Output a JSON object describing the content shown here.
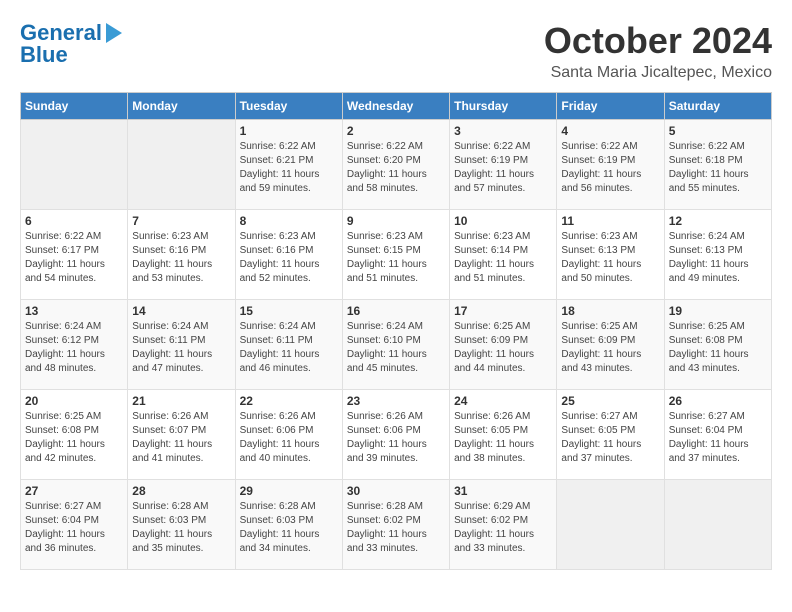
{
  "logo": {
    "line1": "General",
    "line2": "Blue"
  },
  "header": {
    "month": "October 2024",
    "location": "Santa Maria Jicaltepec, Mexico"
  },
  "weekdays": [
    "Sunday",
    "Monday",
    "Tuesday",
    "Wednesday",
    "Thursday",
    "Friday",
    "Saturday"
  ],
  "weeks": [
    [
      {
        "day": "",
        "sunrise": "",
        "sunset": "",
        "daylight": ""
      },
      {
        "day": "",
        "sunrise": "",
        "sunset": "",
        "daylight": ""
      },
      {
        "day": "1",
        "sunrise": "Sunrise: 6:22 AM",
        "sunset": "Sunset: 6:21 PM",
        "daylight": "Daylight: 11 hours and 59 minutes."
      },
      {
        "day": "2",
        "sunrise": "Sunrise: 6:22 AM",
        "sunset": "Sunset: 6:20 PM",
        "daylight": "Daylight: 11 hours and 58 minutes."
      },
      {
        "day": "3",
        "sunrise": "Sunrise: 6:22 AM",
        "sunset": "Sunset: 6:19 PM",
        "daylight": "Daylight: 11 hours and 57 minutes."
      },
      {
        "day": "4",
        "sunrise": "Sunrise: 6:22 AM",
        "sunset": "Sunset: 6:19 PM",
        "daylight": "Daylight: 11 hours and 56 minutes."
      },
      {
        "day": "5",
        "sunrise": "Sunrise: 6:22 AM",
        "sunset": "Sunset: 6:18 PM",
        "daylight": "Daylight: 11 hours and 55 minutes."
      }
    ],
    [
      {
        "day": "6",
        "sunrise": "Sunrise: 6:22 AM",
        "sunset": "Sunset: 6:17 PM",
        "daylight": "Daylight: 11 hours and 54 minutes."
      },
      {
        "day": "7",
        "sunrise": "Sunrise: 6:23 AM",
        "sunset": "Sunset: 6:16 PM",
        "daylight": "Daylight: 11 hours and 53 minutes."
      },
      {
        "day": "8",
        "sunrise": "Sunrise: 6:23 AM",
        "sunset": "Sunset: 6:16 PM",
        "daylight": "Daylight: 11 hours and 52 minutes."
      },
      {
        "day": "9",
        "sunrise": "Sunrise: 6:23 AM",
        "sunset": "Sunset: 6:15 PM",
        "daylight": "Daylight: 11 hours and 51 minutes."
      },
      {
        "day": "10",
        "sunrise": "Sunrise: 6:23 AM",
        "sunset": "Sunset: 6:14 PM",
        "daylight": "Daylight: 11 hours and 51 minutes."
      },
      {
        "day": "11",
        "sunrise": "Sunrise: 6:23 AM",
        "sunset": "Sunset: 6:13 PM",
        "daylight": "Daylight: 11 hours and 50 minutes."
      },
      {
        "day": "12",
        "sunrise": "Sunrise: 6:24 AM",
        "sunset": "Sunset: 6:13 PM",
        "daylight": "Daylight: 11 hours and 49 minutes."
      }
    ],
    [
      {
        "day": "13",
        "sunrise": "Sunrise: 6:24 AM",
        "sunset": "Sunset: 6:12 PM",
        "daylight": "Daylight: 11 hours and 48 minutes."
      },
      {
        "day": "14",
        "sunrise": "Sunrise: 6:24 AM",
        "sunset": "Sunset: 6:11 PM",
        "daylight": "Daylight: 11 hours and 47 minutes."
      },
      {
        "day": "15",
        "sunrise": "Sunrise: 6:24 AM",
        "sunset": "Sunset: 6:11 PM",
        "daylight": "Daylight: 11 hours and 46 minutes."
      },
      {
        "day": "16",
        "sunrise": "Sunrise: 6:24 AM",
        "sunset": "Sunset: 6:10 PM",
        "daylight": "Daylight: 11 hours and 45 minutes."
      },
      {
        "day": "17",
        "sunrise": "Sunrise: 6:25 AM",
        "sunset": "Sunset: 6:09 PM",
        "daylight": "Daylight: 11 hours and 44 minutes."
      },
      {
        "day": "18",
        "sunrise": "Sunrise: 6:25 AM",
        "sunset": "Sunset: 6:09 PM",
        "daylight": "Daylight: 11 hours and 43 minutes."
      },
      {
        "day": "19",
        "sunrise": "Sunrise: 6:25 AM",
        "sunset": "Sunset: 6:08 PM",
        "daylight": "Daylight: 11 hours and 43 minutes."
      }
    ],
    [
      {
        "day": "20",
        "sunrise": "Sunrise: 6:25 AM",
        "sunset": "Sunset: 6:08 PM",
        "daylight": "Daylight: 11 hours and 42 minutes."
      },
      {
        "day": "21",
        "sunrise": "Sunrise: 6:26 AM",
        "sunset": "Sunset: 6:07 PM",
        "daylight": "Daylight: 11 hours and 41 minutes."
      },
      {
        "day": "22",
        "sunrise": "Sunrise: 6:26 AM",
        "sunset": "Sunset: 6:06 PM",
        "daylight": "Daylight: 11 hours and 40 minutes."
      },
      {
        "day": "23",
        "sunrise": "Sunrise: 6:26 AM",
        "sunset": "Sunset: 6:06 PM",
        "daylight": "Daylight: 11 hours and 39 minutes."
      },
      {
        "day": "24",
        "sunrise": "Sunrise: 6:26 AM",
        "sunset": "Sunset: 6:05 PM",
        "daylight": "Daylight: 11 hours and 38 minutes."
      },
      {
        "day": "25",
        "sunrise": "Sunrise: 6:27 AM",
        "sunset": "Sunset: 6:05 PM",
        "daylight": "Daylight: 11 hours and 37 minutes."
      },
      {
        "day": "26",
        "sunrise": "Sunrise: 6:27 AM",
        "sunset": "Sunset: 6:04 PM",
        "daylight": "Daylight: 11 hours and 37 minutes."
      }
    ],
    [
      {
        "day": "27",
        "sunrise": "Sunrise: 6:27 AM",
        "sunset": "Sunset: 6:04 PM",
        "daylight": "Daylight: 11 hours and 36 minutes."
      },
      {
        "day": "28",
        "sunrise": "Sunrise: 6:28 AM",
        "sunset": "Sunset: 6:03 PM",
        "daylight": "Daylight: 11 hours and 35 minutes."
      },
      {
        "day": "29",
        "sunrise": "Sunrise: 6:28 AM",
        "sunset": "Sunset: 6:03 PM",
        "daylight": "Daylight: 11 hours and 34 minutes."
      },
      {
        "day": "30",
        "sunrise": "Sunrise: 6:28 AM",
        "sunset": "Sunset: 6:02 PM",
        "daylight": "Daylight: 11 hours and 33 minutes."
      },
      {
        "day": "31",
        "sunrise": "Sunrise: 6:29 AM",
        "sunset": "Sunset: 6:02 PM",
        "daylight": "Daylight: 11 hours and 33 minutes."
      },
      {
        "day": "",
        "sunrise": "",
        "sunset": "",
        "daylight": ""
      },
      {
        "day": "",
        "sunrise": "",
        "sunset": "",
        "daylight": ""
      }
    ]
  ]
}
